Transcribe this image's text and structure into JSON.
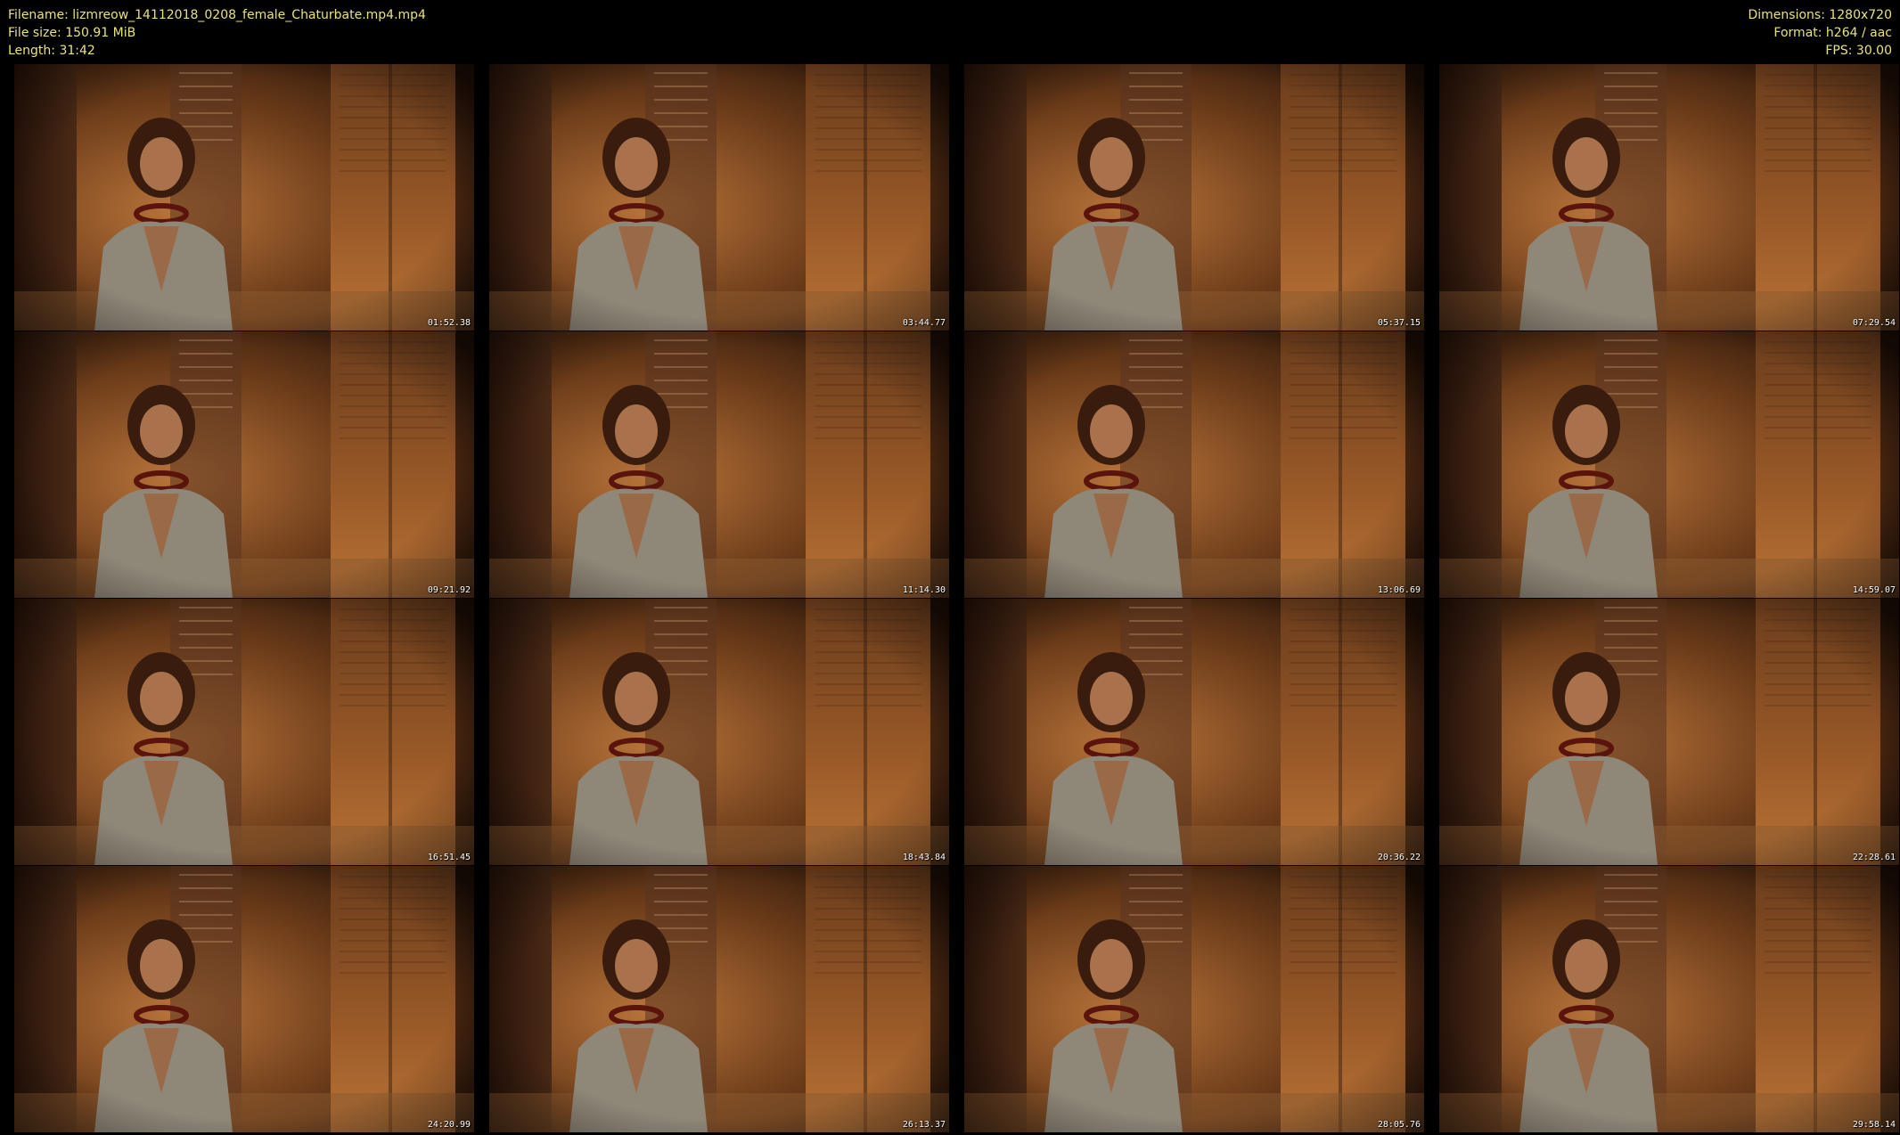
{
  "header": {
    "filename": "Filename: lizmreow_14112018_0208_female_Chaturbate.mp4.mp4",
    "file_size": "File size: 150.91 MiB",
    "length": "Length: 31:42",
    "dimensions": "Dimensions: 1280x720",
    "format": "Format: h264 / aac",
    "fps": "FPS: 30.00"
  },
  "colors": {
    "meta_text": "#e8e27a",
    "background": "#000000",
    "timestamp_text": "#ffffff"
  },
  "thumbnails": [
    {
      "timestamp": "01:52.38"
    },
    {
      "timestamp": "03:44.77"
    },
    {
      "timestamp": "05:37.15"
    },
    {
      "timestamp": "07:29.54"
    },
    {
      "timestamp": "09:21.92"
    },
    {
      "timestamp": "11:14.30"
    },
    {
      "timestamp": "13:06.69"
    },
    {
      "timestamp": "14:59.07"
    },
    {
      "timestamp": "16:51.45"
    },
    {
      "timestamp": "18:43.84"
    },
    {
      "timestamp": "20:36.22"
    },
    {
      "timestamp": "22:28.61"
    },
    {
      "timestamp": "24:20.99"
    },
    {
      "timestamp": "26:13.37"
    },
    {
      "timestamp": "28:05.76"
    },
    {
      "timestamp": "29:58.14"
    }
  ]
}
